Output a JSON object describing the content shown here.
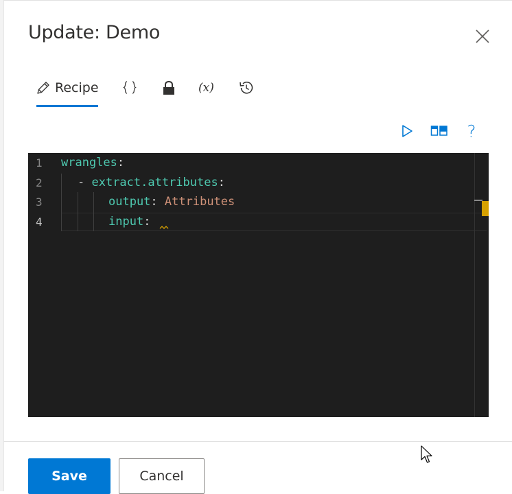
{
  "dialog": {
    "title": "Update: Demo"
  },
  "tabs": [
    {
      "label": "Recipe",
      "icon": "pencil-icon",
      "active": true
    },
    {
      "label": "",
      "icon": "braces-icon"
    },
    {
      "label": "",
      "icon": "lock-icon"
    },
    {
      "label": "",
      "icon": "variable-icon",
      "glyph": "(x)"
    },
    {
      "label": "",
      "icon": "history-icon"
    }
  ],
  "toolbar": {
    "run_icon": "play-icon",
    "layout_icon": "split-view-icon",
    "help_icon": "help-icon",
    "help_glyph": "?"
  },
  "editor": {
    "line_numbers": [
      "1",
      "2",
      "3",
      "4"
    ],
    "active_line": 4,
    "lines": {
      "l1_key": "wrangles",
      "l1_colon": ":",
      "l2_dash": "- ",
      "l2_key": "extract.attributes",
      "l2_colon": ":",
      "l3_key": "output",
      "l3_colon": ": ",
      "l3_value": "Attributes",
      "l4_key": "input",
      "l4_colon": ":"
    }
  },
  "footer": {
    "save_label": "Save",
    "cancel_label": "Cancel"
  },
  "colors": {
    "accent": "#0078d4",
    "editor_bg": "#1e1e1e",
    "yaml_key": "#4ec9b0",
    "yaml_string": "#ce9178",
    "warning": "#d7a100"
  }
}
